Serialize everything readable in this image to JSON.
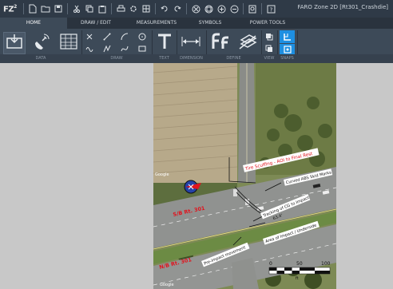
{
  "app": {
    "logo": "FZ",
    "logo_sup": "2",
    "window_title": "FARO Zone 2D [Rt301_Crashdie]"
  },
  "tabs": [
    {
      "label": "HOME",
      "active": true
    },
    {
      "label": "DRAW / EDIT",
      "active": false
    },
    {
      "label": "MEASUREMENTS",
      "active": false
    },
    {
      "label": "SYMBOLS",
      "active": false
    },
    {
      "label": "POWER TOOLS",
      "active": false
    }
  ],
  "ribbon_groups": [
    "DATA",
    "DRAW",
    "TEXT",
    "DIMENSION",
    "DEFINE",
    "VIEW",
    "SNAPS"
  ],
  "map": {
    "labels": {
      "tire_scuffing": "Tire Scuffing - AOI to Final Rest",
      "curved_abs": "Curved ABS Skid Marks",
      "tracking": "Tracking of CG to Impact",
      "tracking_value": "63.4'",
      "area_impact": "Area of Impact / Underside",
      "road_top": "S/B Rt. 301",
      "road_bottom": "N/B Rt. 301",
      "pre_impact": "Pre-impact movement",
      "google_top": "Google",
      "google_bottom": "Google"
    },
    "scale": {
      "ticks": [
        "0",
        "50",
        "100"
      ],
      "unit": "ft"
    }
  },
  "colors": {
    "accent": "#1e8fe1",
    "annotation_red": "#e0141e",
    "titlebar": "#2f3a47",
    "ribbon": "#3d4a58"
  }
}
